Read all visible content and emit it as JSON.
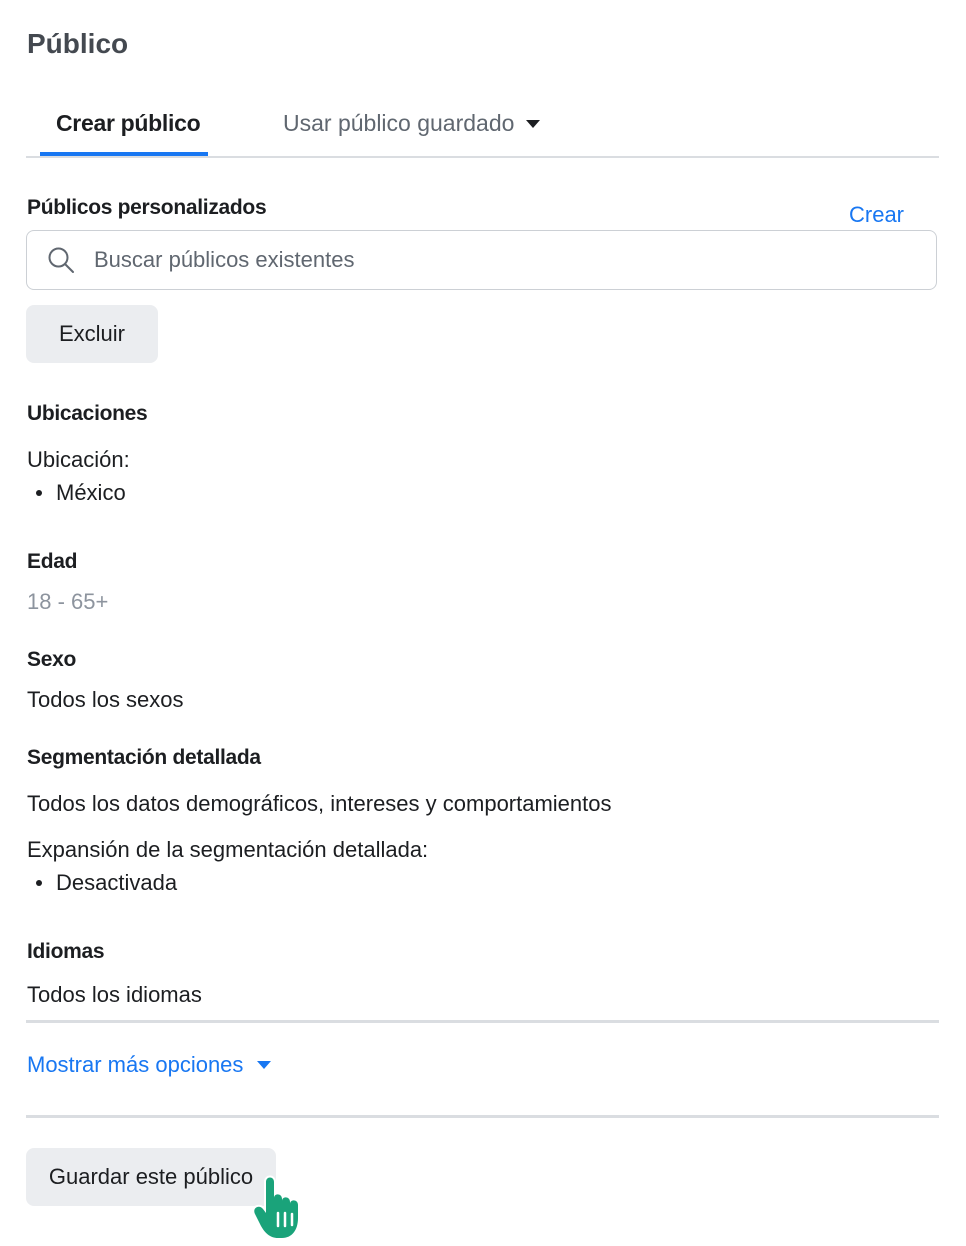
{
  "section": {
    "title": "Público"
  },
  "tabs": [
    {
      "label": "Crear público",
      "active": true
    },
    {
      "label": "Usar público guardado",
      "active": false
    }
  ],
  "custom_audiences": {
    "label": "Públicos personalizados",
    "create_link": "Crear",
    "search_placeholder": "Buscar públicos existentes",
    "exclude_button": "Excluir"
  },
  "locations": {
    "label": "Ubicaciones",
    "sub_label": "Ubicación:",
    "items": [
      "México"
    ]
  },
  "age": {
    "label": "Edad",
    "value": "18 - 65+"
  },
  "gender": {
    "label": "Sexo",
    "value": "Todos los sexos"
  },
  "detailed_targeting": {
    "label": "Segmentación detallada",
    "value": "Todos los datos demográficos, intereses y comportamientos",
    "expansion_label": "Expansión de la segmentación detallada:",
    "expansion_items": [
      "Desactivada"
    ]
  },
  "languages": {
    "label": "Idiomas",
    "value": "Todos los idiomas"
  },
  "more_options": {
    "label": "Mostrar más opciones"
  },
  "save_button": {
    "label": "Guardar este público"
  },
  "colors": {
    "accent": "#1877f2",
    "cursor": "#1aa37a",
    "button_bg": "#ebedf0"
  },
  "icons": {
    "search": "search-icon",
    "cursor": "hand-pointer-icon"
  }
}
